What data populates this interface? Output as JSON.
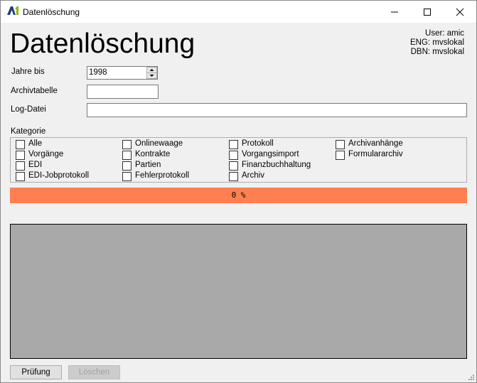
{
  "window": {
    "title": "Datenlöschung"
  },
  "heading": "Datenlöschung",
  "userinfo": {
    "user": "User: amic",
    "eng": "ENG: mvslokal",
    "dbn": "DBN: mvslokal"
  },
  "form": {
    "jahre_label": "Jahre bis",
    "jahre_value": "1998",
    "archivtabelle_label": "Archivtabelle",
    "archivtabelle_value": "",
    "logdatei_label": "Log-Datei",
    "logdatei_value": ""
  },
  "kategorie": {
    "label": "Kategorie",
    "col1": [
      "Alle",
      "Vorgänge",
      "EDI",
      "EDI-Jobprotokoll"
    ],
    "col2": [
      "Onlinewaage",
      "Kontrakte",
      "Partien",
      "Fehlerprotokoll"
    ],
    "col3": [
      "Protokoll",
      "Vorgangsimport",
      "Finanzbuchhaltung",
      "Archiv"
    ],
    "col4": [
      "Archivanhänge",
      "Formulararchiv"
    ]
  },
  "progress": {
    "text": "0 %",
    "value": 0,
    "color": "#ff7f50"
  },
  "buttons": {
    "pruefung": "Prüfung",
    "loeschen": "Löschen"
  }
}
